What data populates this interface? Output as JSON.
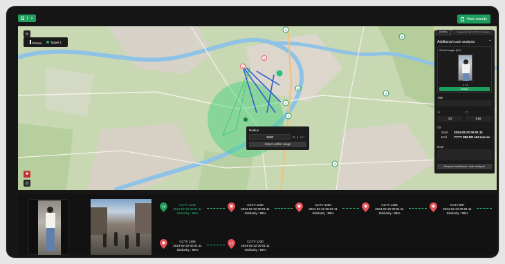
{
  "topbar": {
    "tab_label": "1",
    "close_glyph": "×",
    "view_results_label": "View results"
  },
  "map": {
    "legend": {
      "person_label": "Person",
      "target_label": "Target 1"
    },
    "radius_popup": {
      "title": "Radius",
      "value": "1500",
      "unit_m": "m",
      "unit_km": "km",
      "button_label": "Select within range"
    },
    "markers": [
      "5",
      "2",
      "13",
      "2",
      "4",
      "4",
      "4",
      "4",
      "8",
      "8"
    ]
  },
  "panel": {
    "tag": "CCTV",
    "search_placeholder": "Search for CCTV name",
    "title": "Additional route analysis",
    "select_target_label": "Select target (0/1)",
    "pager": "1 / 1",
    "select_button": "Select",
    "title_label": "Title",
    "people_count": "20",
    "camera_count": "618",
    "start_label": "Start",
    "start_value": "2024-02-22 00:01:11",
    "end_label": "End",
    "end_value": "YYYY MM DD HH:mm:ss",
    "note_label": "Note",
    "request_button": "Request additional route analysis"
  },
  "route": {
    "nodes": [
      {
        "cam": "CCTV 1242",
        "time": "2024-02-22 00:01:11",
        "sim": "Similarity : 96%",
        "badge": "출발"
      },
      {
        "cam": "CCTV 1230",
        "time": "2024-02-22 00:01:11",
        "sim": "Similarity : 96%",
        "badge": ""
      },
      {
        "cam": "CCTV 1230",
        "time": "2024-02-22 00:01:11",
        "sim": "Similarity : 96%",
        "badge": ""
      },
      {
        "cam": "CCTV 1106",
        "time": "2024-02-22 00:01:11",
        "sim": "Similarity : 96%",
        "badge": ""
      },
      {
        "cam": "CCTV 897",
        "time": "2024-02-22 00:01:11",
        "sim": "Similarity : 96%",
        "badge": ""
      },
      {
        "cam": "CCTV 1106",
        "time": "2024-02-22 00:01:11",
        "sim": "Similarity : 96%",
        "badge": ""
      },
      {
        "cam": "CCTV 1230",
        "time": "2024-02-22 00:01:11",
        "sim": "Similarity : 96%",
        "badge": "도착"
      }
    ]
  },
  "colors": {
    "accent": "#1f9d5c",
    "pin_red": "#e8545a",
    "route_blue": "#2d5fcf",
    "radius_green": "#3fd27a"
  }
}
